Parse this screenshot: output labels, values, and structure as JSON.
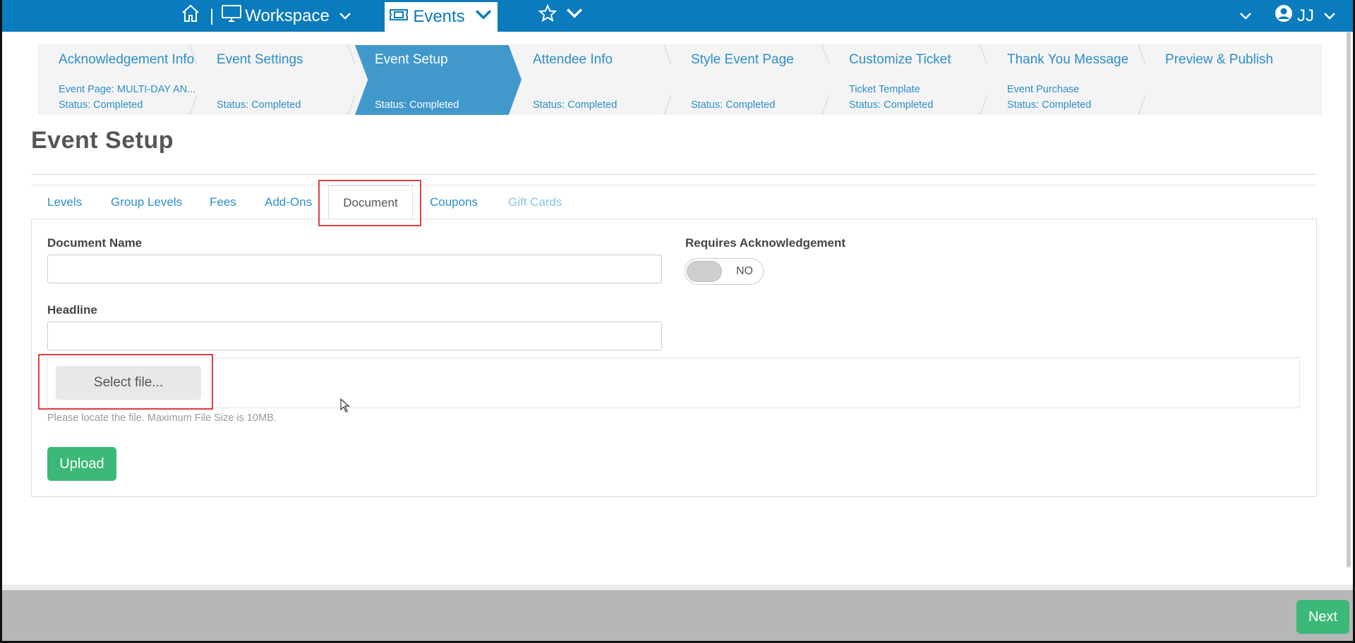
{
  "topnav": {
    "separator": "|",
    "workspace_label": "Workspace",
    "events_label": "Events",
    "user_initials": "JJ",
    "bg_color": "#0a7bbd"
  },
  "steps": [
    {
      "title": "Acknowledgement Info",
      "sub1": "Event Page: MULTI-DAY AN...",
      "sub2": "Status: Completed"
    },
    {
      "title": "Event Settings",
      "sub1": "",
      "sub2": "Status: Completed"
    },
    {
      "title": "Event Setup",
      "sub1": "",
      "sub2": "Status: Completed"
    },
    {
      "title": "Attendee Info",
      "sub1": "",
      "sub2": "Status: Completed"
    },
    {
      "title": "Style Event Page",
      "sub1": "",
      "sub2": "Status: Completed"
    },
    {
      "title": "Customize Ticket",
      "sub1": "Ticket Template",
      "sub2": "Status: Completed"
    },
    {
      "title": "Thank You Message",
      "sub1": "Event Purchase",
      "sub2": "Status: Completed"
    },
    {
      "title": "Preview & Publish",
      "sub1": "",
      "sub2": ""
    }
  ],
  "page": {
    "title": "Event Setup"
  },
  "tabs": [
    {
      "label": "Levels"
    },
    {
      "label": "Group Levels"
    },
    {
      "label": "Fees"
    },
    {
      "label": "Add-Ons"
    },
    {
      "label": "Document"
    },
    {
      "label": "Coupons"
    },
    {
      "label": "Gift Cards"
    }
  ],
  "form": {
    "document_name_label": "Document Name",
    "document_name_value": "",
    "requires_ack_label": "Requires Acknowledgement",
    "toggle_text": "NO",
    "headline_label": "Headline",
    "headline_value": "",
    "select_file_label": "Select file...",
    "help_text": "Please locate the file. Maximum File Size is 10MB.",
    "upload_label": "Upload"
  },
  "footer": {
    "next_label": "Next"
  },
  "colors": {
    "accent": "#2d8ec9",
    "active_step": "#4098cb",
    "success": "#3cb878",
    "highlight": "#e0403f"
  }
}
